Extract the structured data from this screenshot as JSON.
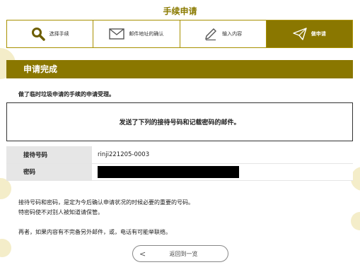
{
  "page": {
    "title": "手续申请"
  },
  "steps": [
    {
      "label": "选择手续",
      "icon": "search-icon",
      "active": false
    },
    {
      "label": "邮件地址的确认",
      "icon": "mail-icon",
      "active": false
    },
    {
      "label": "输入内容",
      "icon": "pencil-icon",
      "active": false
    },
    {
      "label": "做申请",
      "icon": "send-icon",
      "active": true
    }
  ],
  "banner": {
    "title": "申请完成"
  },
  "intro": "做了临时垃圾申请的手续的申请受理。",
  "notice": "发送了下列的接待号码和记载密码的邮件。",
  "details": {
    "reception_label": "接待号码",
    "reception_value": "rinji221205-0003",
    "password_label": "密码"
  },
  "info": {
    "line1": "接待号码和密码，是定为今后确认申请状况的时候必要的重要的号码。",
    "line2": "特密码使不对别人被知道请保管。",
    "line3": "再者，如果内容有不完备另外邮件，或，电话有可能举联络。"
  },
  "back_button": {
    "label": "返回到一览",
    "icon": "chevron-left-icon"
  },
  "colors": {
    "accent": "#8a7700",
    "title": "#8a7a00",
    "table_header": "#e6e6e6",
    "decor": "#f4edc9"
  }
}
